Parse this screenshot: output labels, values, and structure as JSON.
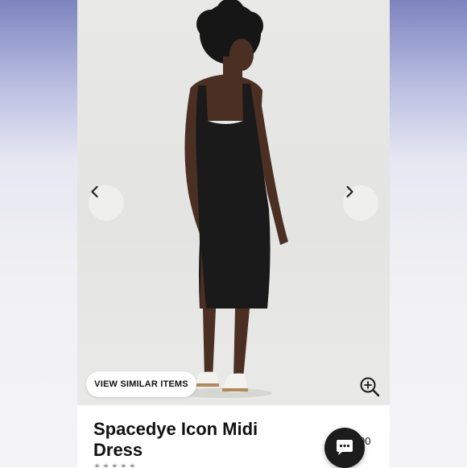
{
  "product": {
    "title": "Spacedye Icon Midi Dress",
    "price_fragment": "00",
    "rating_stars": "★★★★★"
  },
  "actions": {
    "view_similar_label": "VIEW SIMILAR ITEMS"
  },
  "icons": {
    "prev": "chevron-left-icon",
    "next": "chevron-right-icon",
    "zoom": "zoom-in-icon",
    "chat": "chat-bubble-icon"
  },
  "colors": {
    "dress": "#1a1a1a",
    "chat_button": "#1c1c1c",
    "photo_background": "#e6e6e4"
  }
}
